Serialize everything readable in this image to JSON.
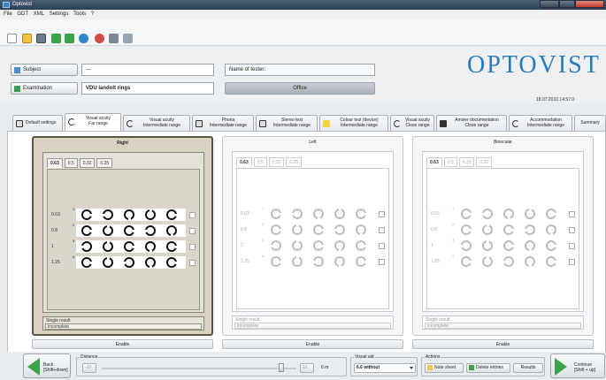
{
  "window": {
    "title": "Optovist"
  },
  "menu": [
    "File",
    "GDT",
    "XML",
    "Settings",
    "Tools",
    "?"
  ],
  "toolbar_icons": [
    "new-icon",
    "open-icon",
    "save-icon",
    "arrow-down-icon",
    "arrow-up-icon",
    "refresh-icon",
    "record-icon",
    "print-icon",
    "print-preview-icon"
  ],
  "info": {
    "subject_label": "Subject",
    "subject_value": "---",
    "examination_label": "Examination",
    "examination_value": "VDU landolt rings",
    "tester_label": "Name of tester:",
    "tester_value": "",
    "mode_label": "Office"
  },
  "logo": {
    "text": "OPTOVIST",
    "datetime": "18.07.2010  14:57:0"
  },
  "tabs": [
    {
      "label": "Default settings"
    },
    {
      "label": "Visual acuity\nFar range"
    },
    {
      "label": "Visual acuity\nIntermediate range"
    },
    {
      "label": "Phoria\nIntermediate range"
    },
    {
      "label": "Stereo test\nIntermediate range"
    },
    {
      "label": "Colour test (device)\nIntermediate range"
    },
    {
      "label": "Visual acuity\nClose range"
    },
    {
      "label": "Amsler documentation\nClose range"
    },
    {
      "label": "Accommodation\nIntermediate range"
    },
    {
      "label": "Summary"
    }
  ],
  "panels": [
    {
      "title": "Right",
      "steps": [
        "0.63",
        "0.5",
        "0.32",
        "0.25"
      ],
      "rows": [
        "0.63",
        "0.8",
        "1",
        "1.25"
      ],
      "row_nums": [
        "1",
        "2",
        "3",
        "4"
      ],
      "single_label": "Single result",
      "single_value": "incomplete",
      "enable_label": "Enable"
    },
    {
      "title": "Left",
      "steps": [
        "0.63",
        "0.5",
        "0.32",
        "0.25"
      ],
      "rows": [
        "0.63",
        "0.8",
        "1",
        "1.25"
      ],
      "row_nums": [
        "1",
        "2",
        "3",
        "4"
      ],
      "single_label": "Single result",
      "single_value": "incomplete",
      "enable_label": "Enable"
    },
    {
      "title": "Binocular",
      "steps": [
        "0.63",
        "0.5",
        "0.32",
        "0.25"
      ],
      "rows": [
        "0.63",
        "0.8",
        "1",
        "1.25"
      ],
      "row_nums": [
        "1",
        "2",
        "3",
        "4"
      ],
      "single_label": "Single result",
      "single_value": "incomplete",
      "enable_label": "Enable"
    }
  ],
  "bottom": {
    "back_label": "Back\n[Shift+down]",
    "distance_label": "Distance",
    "distance_min": "-10",
    "distance_max": "10",
    "distance_value": "6 m",
    "visual_aid_label": "Visual aid",
    "visual_aid_value": "6.6 without",
    "actions_label": "Actions",
    "note_sheet": "Note sheet",
    "delete_entries": "Delete entries",
    "results": "Results",
    "continue_label": "Continue\n[Shift + up]"
  }
}
